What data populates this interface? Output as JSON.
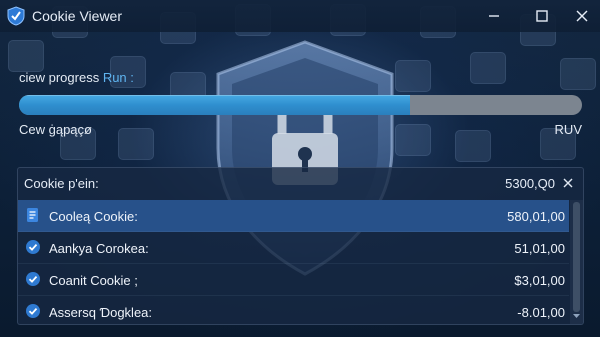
{
  "window": {
    "title": "Cookie Viewer",
    "controls": [
      "minimize-icon",
      "maximize-icon",
      "close-icon"
    ]
  },
  "progress": {
    "label": "ciew progress ",
    "label_accent": "Run :",
    "fraction": 0.695,
    "status_left": "Cew ġąpąçø",
    "status_right": "RUV",
    "fill_color": "#2f8fcf",
    "track_color": "#7c8590"
  },
  "panel": {
    "title": "Cookie p'ein:",
    "total": "5300,Q0",
    "close_icon": "close-icon",
    "rows": [
      {
        "icon": "document-icon",
        "name": "Cooleą Cookie:",
        "value": "580,01,00",
        "selected": true
      },
      {
        "icon": "check-circle-icon",
        "name": "Aankya Corokea:",
        "value": "51,01,00",
        "selected": false
      },
      {
        "icon": "check-circle-icon",
        "name": "Coanit Cookie ;",
        "value": "$3,01,00",
        "selected": false
      },
      {
        "icon": "check-circle-icon",
        "name": "Assersq Ɗogklea:",
        "value": "-8.01,00",
        "selected": false
      }
    ]
  },
  "colors": {
    "accent": "#5fb4f0",
    "selected_row": "#27518a",
    "background": "#0b1a2e"
  }
}
